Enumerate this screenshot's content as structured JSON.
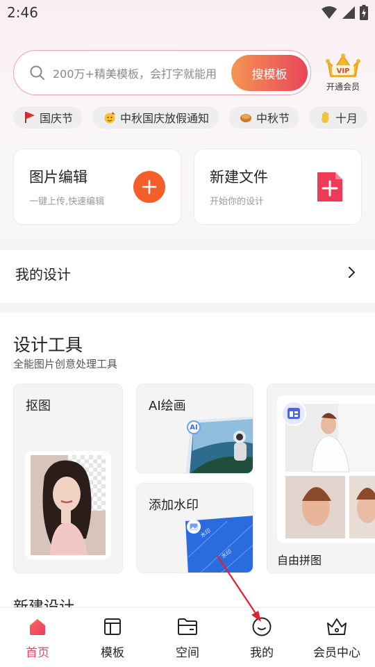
{
  "status_bar": {
    "time": "2:46"
  },
  "search": {
    "placeholder": "200万+精美模板，会打字就能用",
    "button_label": "搜模板"
  },
  "vip": {
    "badge": "VIP",
    "label": "开通会员"
  },
  "chips": [
    {
      "icon": "red-flag-icon",
      "label": "国庆节"
    },
    {
      "icon": "party-face-icon",
      "label": "中秋国庆放假通知"
    },
    {
      "icon": "mooncake-icon",
      "label": "中秋节"
    },
    {
      "icon": "hand-icon",
      "label": "十月"
    }
  ],
  "quick_cards": {
    "image_edit": {
      "title": "图片编辑",
      "subtitle": "一键上传,快速编辑"
    },
    "new_file": {
      "title": "新建文件",
      "subtitle": "开始你的设计"
    }
  },
  "my_design": {
    "label": "我的设计"
  },
  "design_tools": {
    "title": "设计工具",
    "subtitle": "全能图片创意处理工具",
    "cutout": "抠图",
    "ai_paint": "AI绘画",
    "watermark": "添加水印",
    "watermark_text": "水印",
    "collage": "自由拼图",
    "ai_badge": "AI"
  },
  "next_section_partial": "新建设计",
  "bottom_nav": {
    "home": "首页",
    "templates": "模板",
    "space": "空间",
    "mine": "我的",
    "member": "会员中心"
  },
  "colors": {
    "accent": "#f0445b",
    "orange": "#f45e2b",
    "gradient_start": "#f59552",
    "gradient_end": "#e8455b"
  }
}
